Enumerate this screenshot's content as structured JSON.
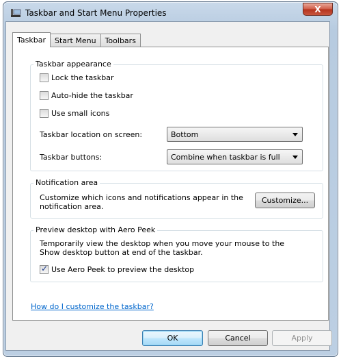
{
  "window": {
    "title": "Taskbar and Start Menu Properties",
    "close_label": "X"
  },
  "tabs": [
    "Taskbar",
    "Start Menu",
    "Toolbars"
  ],
  "appearance": {
    "legend": "Taskbar appearance",
    "lock": {
      "label": "Lock the taskbar",
      "checked": false
    },
    "autohide": {
      "label": "Auto-hide the taskbar",
      "checked": false
    },
    "small_icons": {
      "label": "Use small icons",
      "checked": false
    },
    "location_label": "Taskbar location on screen:",
    "location_value": "Bottom",
    "buttons_label": "Taskbar buttons:",
    "buttons_value": "Combine when taskbar is full"
  },
  "notification": {
    "legend": "Notification area",
    "text_line1": "Customize which icons and notifications appear in the",
    "text_line2": "notification area.",
    "customize_label": "Customize..."
  },
  "aero_peek": {
    "legend": "Preview desktop with Aero Peek",
    "text_line1": "Temporarily view the desktop when you move your mouse to the",
    "text_line2": "Show desktop button at end of the taskbar.",
    "use_peek": {
      "label": "Use Aero Peek to preview the desktop",
      "checked": true
    }
  },
  "help_link": "How do I customize the taskbar?",
  "footer": {
    "ok": "OK",
    "cancel": "Cancel",
    "apply": "Apply"
  }
}
